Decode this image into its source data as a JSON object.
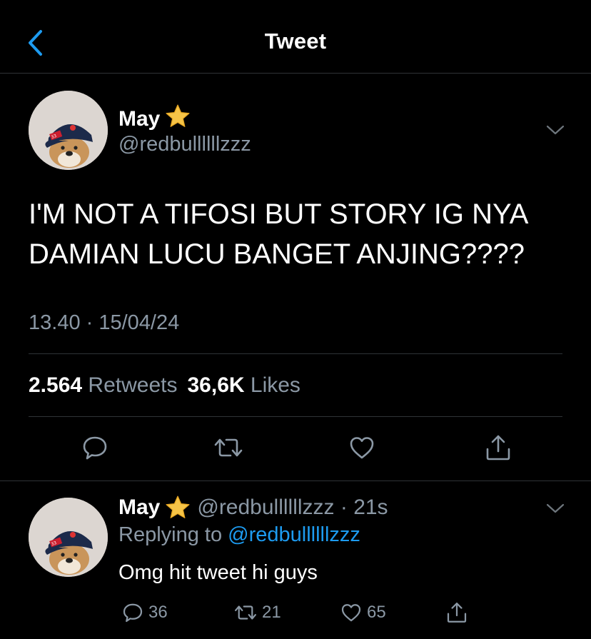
{
  "header": {
    "title": "Tweet",
    "back_icon": "chevron-left-icon"
  },
  "colors": {
    "background": "#000000",
    "text": "#ffffff",
    "muted": "#8b98a5",
    "link": "#1d9bf0",
    "divider": "#2f3336"
  },
  "tweet": {
    "author_name": "May",
    "author_emoji": "⭐",
    "handle": "@redbullllllzzz",
    "text": "I'M NOT A TIFOSI BUT STORY IG NYA DAMIAN LUCU BANGET ANJING????",
    "timestamp": "13.40 · 15/04/24",
    "retweets_count": "2.564",
    "retweets_label": "Retweets",
    "likes_count": "36,6K",
    "likes_label": "Likes"
  },
  "reply": {
    "author_name": "May",
    "author_emoji": "⭐",
    "handle_time": "@redbullllllzzz · 21s",
    "replying_prefix": "Replying to",
    "replying_to": "@redbullllllzzz",
    "text": "Omg hit tweet hi guys",
    "reply_count": "36",
    "retweet_count": "21",
    "like_count": "65"
  }
}
